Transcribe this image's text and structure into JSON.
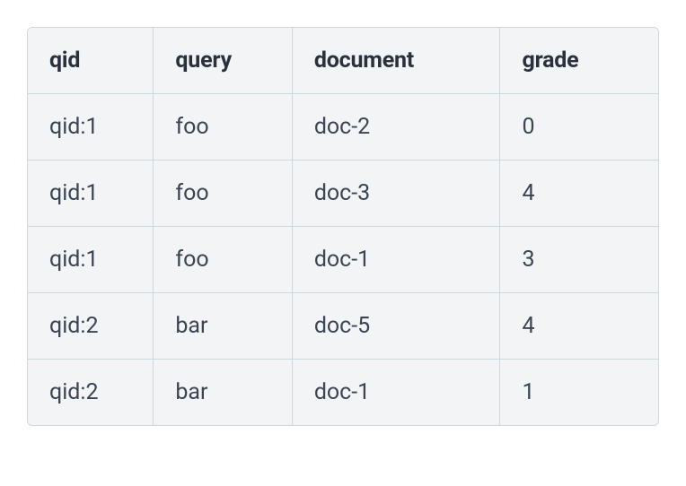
{
  "chart_data": {
    "type": "table",
    "headers": [
      "qid",
      "query",
      "document",
      "grade"
    ],
    "rows": [
      [
        "qid:1",
        "foo",
        "doc-2",
        "0"
      ],
      [
        "qid:1",
        "foo",
        "doc-3",
        "4"
      ],
      [
        "qid:1",
        "foo",
        "doc-1",
        "3"
      ],
      [
        "qid:2",
        "bar",
        "doc-5",
        "4"
      ],
      [
        "qid:2",
        "bar",
        "doc-1",
        "1"
      ]
    ]
  }
}
